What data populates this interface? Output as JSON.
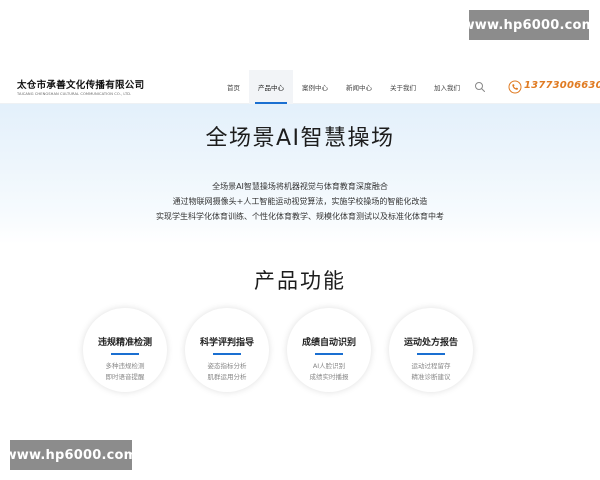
{
  "watermark": {
    "top": "www.hp6000.com",
    "bottom": "www.hp6000.com"
  },
  "header": {
    "logo_cn": "太仓市承善文化传播有限公司",
    "logo_en": "TAICANG CHENGSHAN CULTURAL COMMUNICATION CO., LTD.",
    "nav": [
      {
        "label": "首页",
        "active": false
      },
      {
        "label": "产品中心",
        "active": true
      },
      {
        "label": "案例中心",
        "active": false
      },
      {
        "label": "新闻中心",
        "active": false
      },
      {
        "label": "关于我们",
        "active": false
      },
      {
        "label": "加入我们",
        "active": false
      }
    ],
    "search_icon": "search-icon",
    "phone_icon": "phone-icon",
    "phone": "13773006630",
    "accent_color": "#e07b22"
  },
  "banner": {
    "title": "全场景AI智慧操场",
    "lines": [
      "全场景AI智慧操场将机器视觉与体育教育深度融合",
      "通过物联网摄像头+人工智能运动视觉算法，实施学校操场的智能化改造",
      "实现学生科学化体育训练、个性化体育教学、规模化体育测试以及标准化体育中考"
    ]
  },
  "features": {
    "title": "产品功能",
    "cards": [
      {
        "title": "违规精准检测",
        "lines": [
          "多种违规检测",
          "即时语音提醒"
        ]
      },
      {
        "title": "科学评判指导",
        "lines": [
          "姿态指标分析",
          "肌群运用分析"
        ]
      },
      {
        "title": "成绩自动识别",
        "lines": [
          "AI人脸识别",
          "成绩实时播报"
        ]
      },
      {
        "title": "运动处方报告",
        "lines": [
          "运动过程留存",
          "精准诊断建议"
        ]
      }
    ],
    "bar_color": "#1a6fd1"
  }
}
